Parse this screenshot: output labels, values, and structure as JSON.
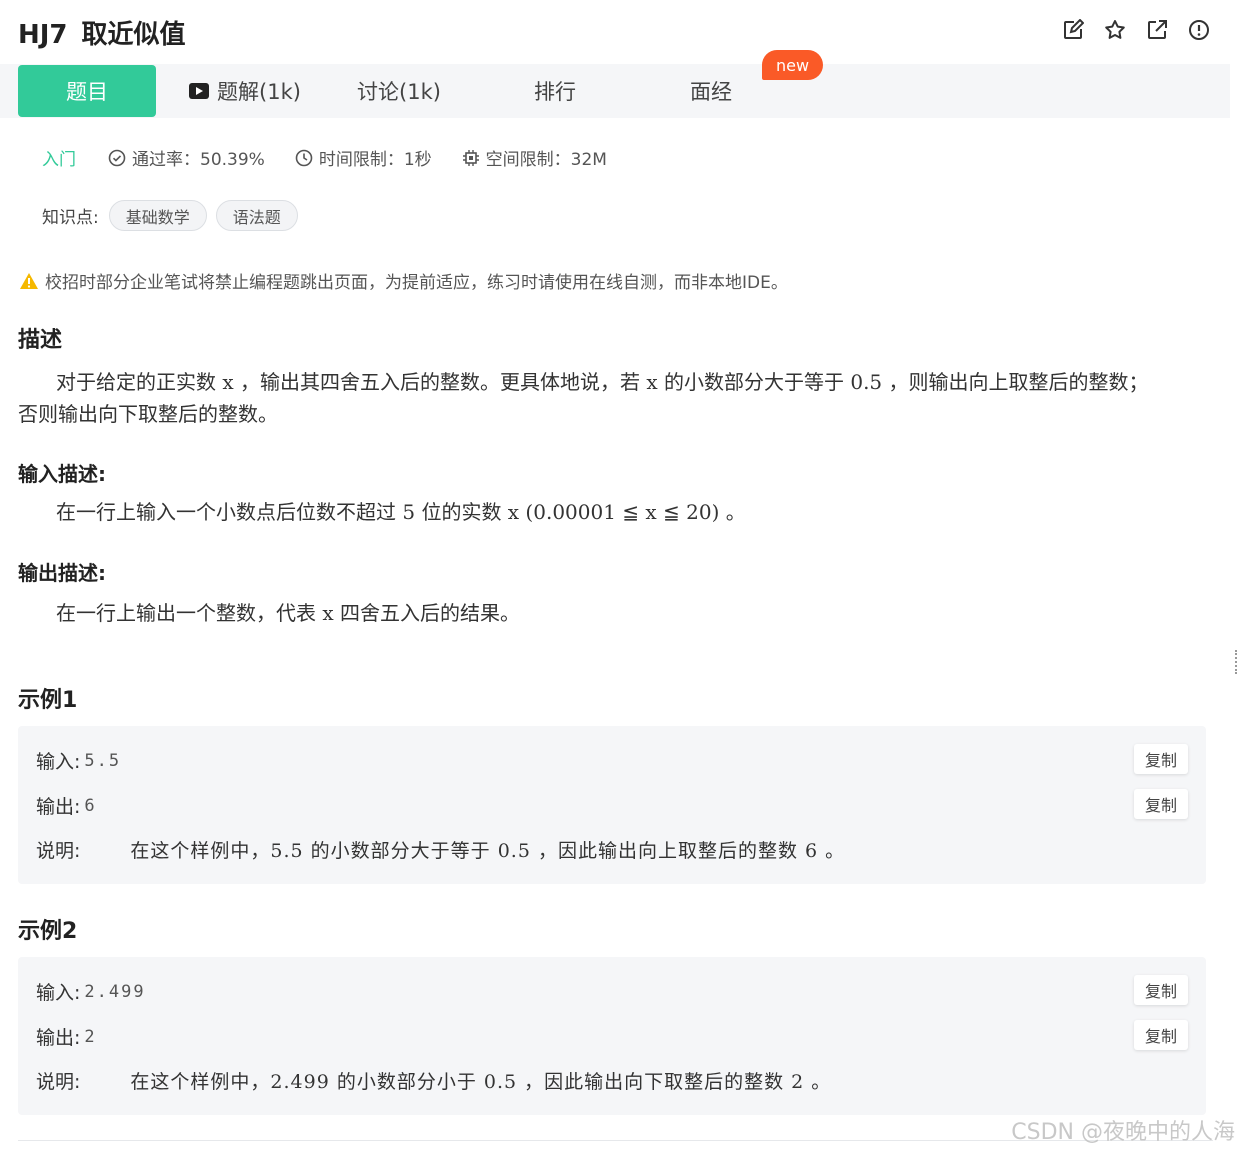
{
  "header": {
    "code": "HJ7",
    "title": "取近似值",
    "icons": [
      "edit-icon",
      "star-icon",
      "share-icon",
      "report-icon"
    ]
  },
  "tabs": [
    {
      "label": "题目",
      "active": true
    },
    {
      "label": "题解(1k)",
      "icon": "video-icon"
    },
    {
      "label": "讨论(1k)"
    },
    {
      "label": "排行"
    },
    {
      "label": "面经"
    }
  ],
  "new_badge": "new",
  "meta": {
    "level": "入门",
    "pass_rate": "通过率：50.39%",
    "time_limit": "时间限制：1秒",
    "space_limit": "空间限制：32M"
  },
  "knowledge": {
    "label": "知识点:",
    "tags": [
      "基础数学",
      "语法题"
    ]
  },
  "warning": "校招时部分企业笔试将禁止编程题跳出页面，为提前适应，练习时请使用在线自测，而非本地IDE。",
  "description": {
    "title": "描述",
    "text_line1": "对于给定的正实数 x ，输出其四舍五入后的整数。更具体地说，若 x 的小数部分大于等于 0.5 ，则输出向上取整后的整数；",
    "text_line2": "否则输出向下取整后的整数。"
  },
  "input_desc": {
    "title": "输入描述:",
    "text": "在一行上输入一个小数点后位数不超过 5 位的实数 x (0.00001 ≦ x ≦ 20) 。"
  },
  "output_desc": {
    "title": "输出描述:",
    "text": "在一行上输出一个整数，代表 x 四舍五入后的结果。"
  },
  "examples": [
    {
      "title": "示例1",
      "input_label": "输入:",
      "input": "5.5",
      "output_label": "输出:",
      "output": "6",
      "explain_label": "说明:",
      "explain": "在这个样例中，5.5 的小数部分大于等于 0.5 ，因此输出向上取整后的整数 6 。",
      "copy_label": "复制"
    },
    {
      "title": "示例2",
      "input_label": "输入:",
      "input": "2.499",
      "output_label": "输出:",
      "output": "2",
      "explain_label": "说明:",
      "explain": "在这个样例中，2.499 的小数部分小于 0.5 ，因此输出向下取整后的整数 2 。",
      "copy_label": "复制"
    }
  ],
  "watermark": "CSDN @夜晚中的人海",
  "colors": {
    "accent": "#32ca99",
    "badge": "#fa5a27",
    "warning": "#f5b800"
  }
}
